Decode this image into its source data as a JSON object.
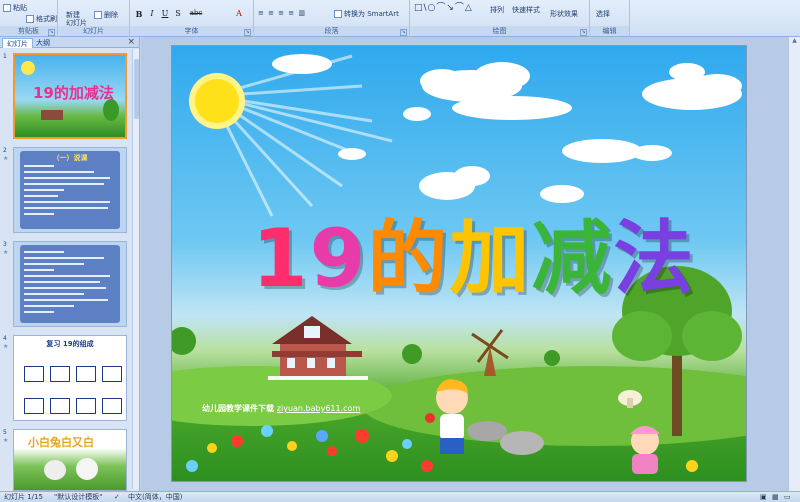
{
  "ribbon": {
    "groups": [
      {
        "name": "clipboard",
        "label": "剪贴板"
      },
      {
        "name": "slides",
        "label": "幻灯片"
      },
      {
        "name": "font",
        "label": "字体"
      },
      {
        "name": "paragraph",
        "label": "段落"
      },
      {
        "name": "drawing",
        "label": "绘图"
      },
      {
        "name": "editing",
        "label": "编辑"
      }
    ],
    "paste": "粘贴",
    "format_painter": "格式刷",
    "new_slide": "新建\n幻灯片",
    "delete": "删除",
    "convert_smartart": "转换为 SmartArt",
    "arrange": "排列",
    "quick_styles": "快速样式",
    "shape_effects": "形状效果",
    "select": "选择",
    "format_buttons": [
      "B",
      "I",
      "U",
      "S",
      "abc",
      "A"
    ]
  },
  "pane": {
    "tab_slides": "幻灯片",
    "tab_outline": "大纲",
    "close": "×",
    "thumbs": [
      {
        "num": "1",
        "title": "19的加减法"
      },
      {
        "num": "2",
        "title": "（一）说课"
      },
      {
        "num": "3",
        "title": ""
      },
      {
        "num": "4",
        "title": "复习  19的组成"
      },
      {
        "num": "5",
        "title": "小白兔白又白"
      }
    ]
  },
  "slide": {
    "title_chars": [
      "1",
      "9",
      "的",
      "加",
      "减",
      "法"
    ],
    "watermark_text": "幼儿园教学课件下载",
    "watermark_url": "ziyuan.baby611.com"
  },
  "status": {
    "slide_count": "幻灯片 1/15",
    "theme": "\"默认设计模板\"",
    "language": "中文(简体，中国)"
  },
  "colors": {
    "title": [
      "#ff2d6e",
      "#e83aa8",
      "#ff8a00",
      "#ffd200",
      "#3ab53a",
      "#7a3fe0"
    ]
  }
}
